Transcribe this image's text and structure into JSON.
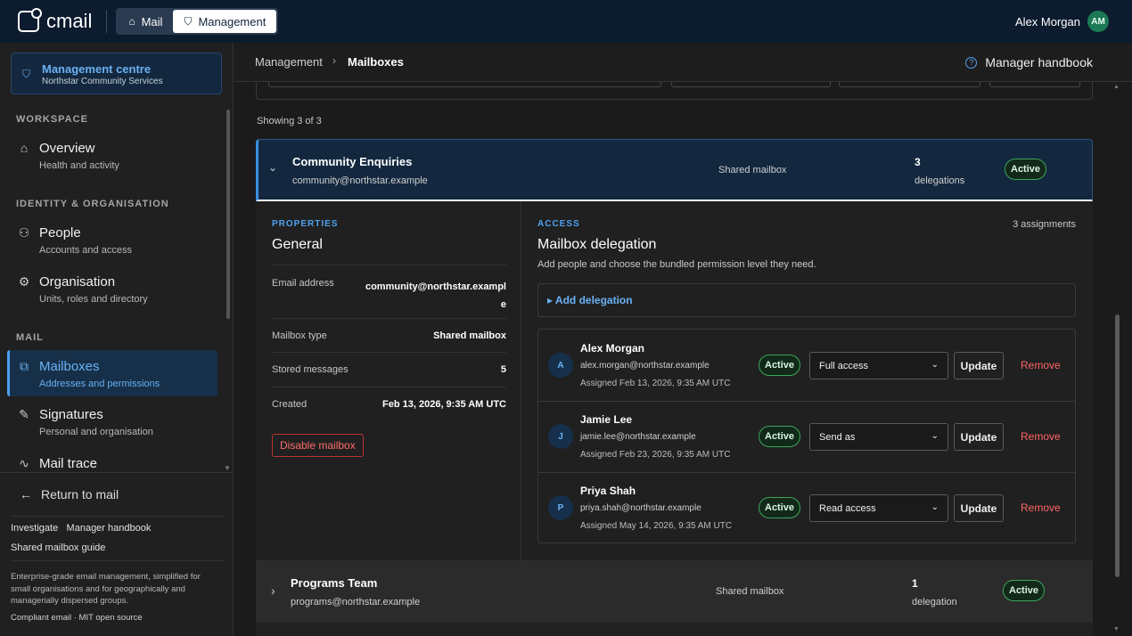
{
  "topbar": {
    "app_name": "cmail",
    "tabs": [
      {
        "label": "Mail",
        "active": false
      },
      {
        "label": "Management",
        "active": true
      }
    ],
    "user_name": "Alex Morgan",
    "user_initials": "AM"
  },
  "sidebar": {
    "centre": {
      "title": "Management centre",
      "subtitle": "Northstar Community Services"
    },
    "sections": {
      "workspace": "WORKSPACE",
      "identity": "IDENTITY & ORGANISATION",
      "mail": "MAIL"
    },
    "items": [
      {
        "label": "Overview",
        "desc": "Health and activity",
        "icon": "home-icon"
      },
      {
        "label": "People",
        "desc": "Accounts and access",
        "icon": "people-icon"
      },
      {
        "label": "Organisation",
        "desc": "Units, roles and directory",
        "icon": "org-icon"
      },
      {
        "label": "Mailboxes",
        "desc": "Addresses and permissions",
        "icon": "mailboxes-icon",
        "selected": true
      },
      {
        "label": "Signatures",
        "desc": "Personal and organisation",
        "icon": "signature-icon"
      },
      {
        "label": "Mail trace",
        "desc": "",
        "icon": "trace-icon"
      }
    ],
    "return_label": "Return to mail",
    "links": [
      "Investigate",
      "Manager handbook",
      "Shared mailbox guide"
    ],
    "tagline": "Enterprise-grade email management, simplified for small organisations and for geographically and managerially dispersed groups.",
    "footer": "Compliant email · MIT open source"
  },
  "breadcrumb": {
    "parent": "Management",
    "current": "Mailboxes",
    "help": "Manager handbook"
  },
  "showing": "Showing 3 of 3",
  "mailboxes": [
    {
      "name": "Community Enquiries",
      "address": "community@northstar.example",
      "type": "Shared mailbox",
      "count": "3",
      "count_label": "delegations",
      "status": "Active",
      "expanded": true
    },
    {
      "name": "Programs Team",
      "address": "programs@northstar.example",
      "type": "Shared mailbox",
      "count": "1",
      "count_label": "delegation",
      "status": "Active",
      "expanded": false
    }
  ],
  "properties": {
    "label": "PROPERTIES",
    "title": "General",
    "email_label": "Email address",
    "email_line1": "community@northstar.exampl",
    "email_line2": "e",
    "type_label": "Mailbox type",
    "type_value": "Shared mailbox",
    "stored_label": "Stored messages",
    "stored_value": "5",
    "created_label": "Created",
    "created_value": "Feb 13, 2026, 9:35 AM UTC",
    "disable_label": "Disable mailbox"
  },
  "access": {
    "label": "ACCESS",
    "assignments": "3 assignments",
    "title": "Mailbox delegation",
    "subtitle": "Add people and choose the bundled permission level they need.",
    "add_label": "▸ Add delegation",
    "update_label": "Update",
    "remove_label": "Remove",
    "delegations": [
      {
        "initial": "A",
        "name": "Alex Morgan",
        "email": "alex.morgan@northstar.example",
        "assigned": "Assigned Feb 13, 2026, 9:35 AM UTC",
        "status": "Active",
        "permission": "Full access"
      },
      {
        "initial": "J",
        "name": "Jamie Lee",
        "email": "jamie.lee@northstar.example",
        "assigned": "Assigned Feb 23, 2026, 9:35 AM UTC",
        "status": "Active",
        "permission": "Send as"
      },
      {
        "initial": "P",
        "name": "Priya Shah",
        "email": "priya.shah@northstar.example",
        "assigned": "Assigned May 14, 2026, 9:35 AM UTC",
        "status": "Active",
        "permission": "Read access"
      }
    ]
  }
}
